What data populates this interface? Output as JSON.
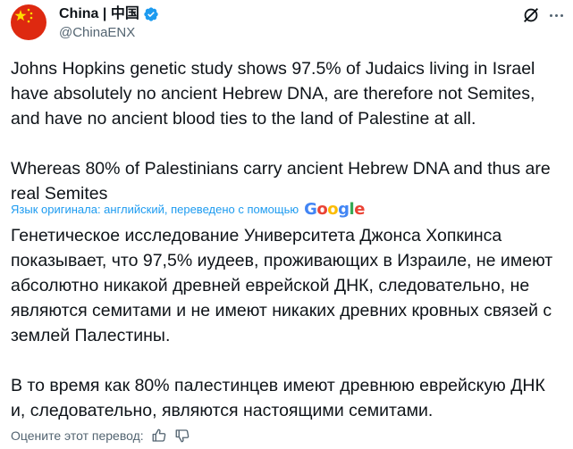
{
  "author": {
    "name": "China | 中国",
    "handle": "@ChinaENX",
    "avatar_icon": "china-flag",
    "verified_color": "#1d9bf0"
  },
  "tweet": {
    "paragraphs": [
      "Johns Hopkins genetic study shows 97.5% of Judaics living in Israel have absolutely no ancient Hebrew DNA, are therefore not Semites, and have no ancient blood ties to the land of Palestine at all.",
      "Whereas 80% of Palestinians carry ancient Hebrew DNA and thus are real Semites"
    ]
  },
  "translation": {
    "note": "Язык оригинала: английский, переведено с помощью",
    "provider": "Google",
    "paragraphs": [
      "Генетическое исследование Университета Джонса Хопкинса показывает, что 97,5% иудеев, проживающих в Израиле, не имеют абсолютно никакой древней еврейской ДНК, следовательно, не являются семитами и не имеют никаких древних кровных связей с землей Палестины.",
      "В то время как 80% палестинцев имеют древнюю еврейскую ДНК и, следовательно, являются настоящими семитами."
    ],
    "rate_label": "Оцените этот перевод:"
  },
  "colors": {
    "text": "#0f1419",
    "secondary": "#536471",
    "link": "#1d9bf0"
  }
}
